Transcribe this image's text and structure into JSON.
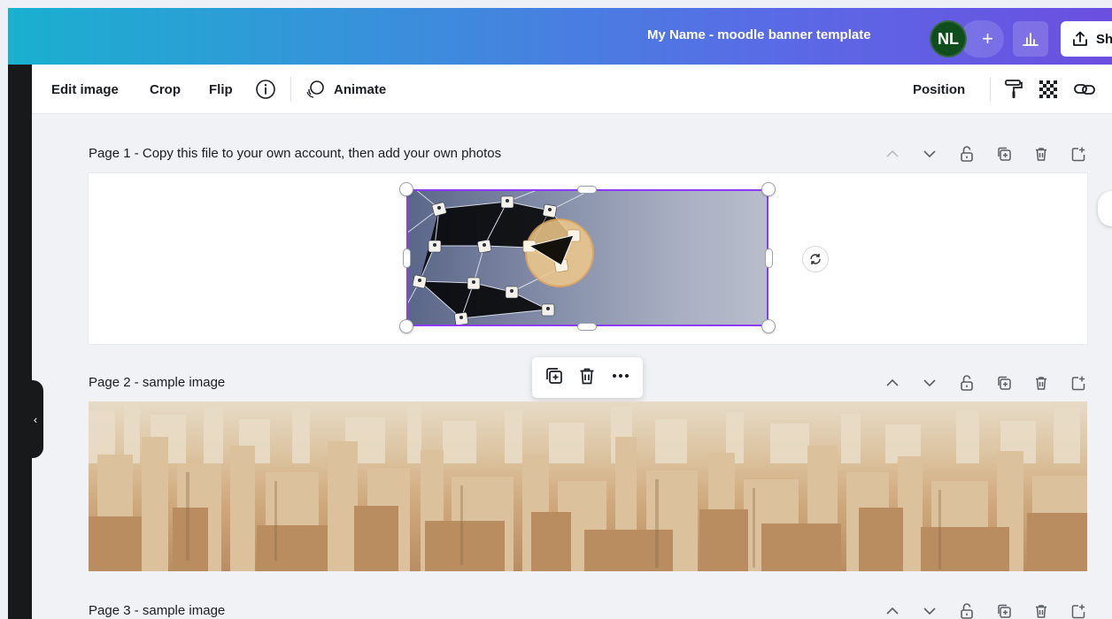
{
  "header": {
    "title": "My Name - moodle banner template",
    "avatar_initials": "NL",
    "add_member": "+",
    "share_label": "Sh"
  },
  "toolbar": {
    "edit_image": "Edit image",
    "crop": "Crop",
    "flip": "Flip",
    "animate": "Animate",
    "position": "Position"
  },
  "pages": [
    {
      "label": "Page 1 - Copy this file to your own account, then add your own photos"
    },
    {
      "label": "Page 2 - sample image"
    },
    {
      "label": "Page 3 - sample image"
    }
  ],
  "colors": {
    "accent": "#8b3dff",
    "sidebar": "#18191b",
    "avatar": "#0f4d1c"
  }
}
